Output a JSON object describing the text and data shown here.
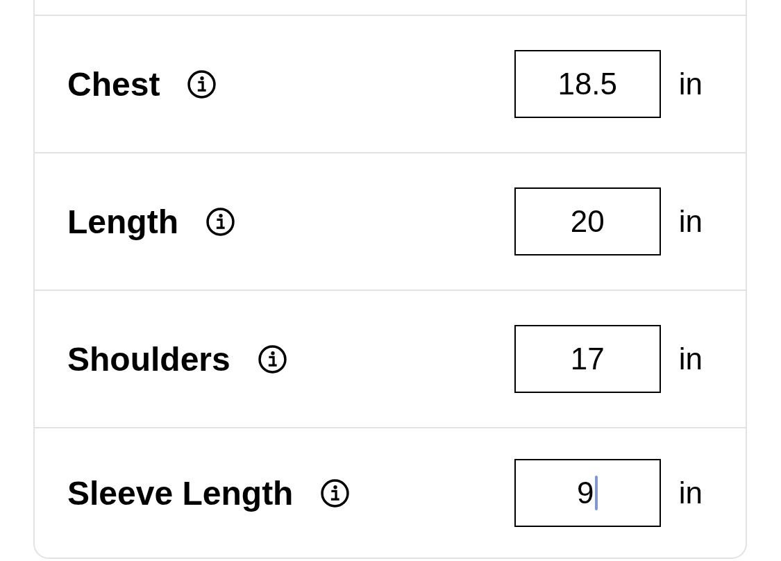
{
  "measurements": [
    {
      "label": "Chest",
      "value": "18.5",
      "unit": "in",
      "focused": false
    },
    {
      "label": "Length",
      "value": "20",
      "unit": "in",
      "focused": false
    },
    {
      "label": "Shoulders",
      "value": "17",
      "unit": "in",
      "focused": false
    },
    {
      "label": "Sleeve Length",
      "value": "9",
      "unit": "in",
      "focused": true
    }
  ]
}
